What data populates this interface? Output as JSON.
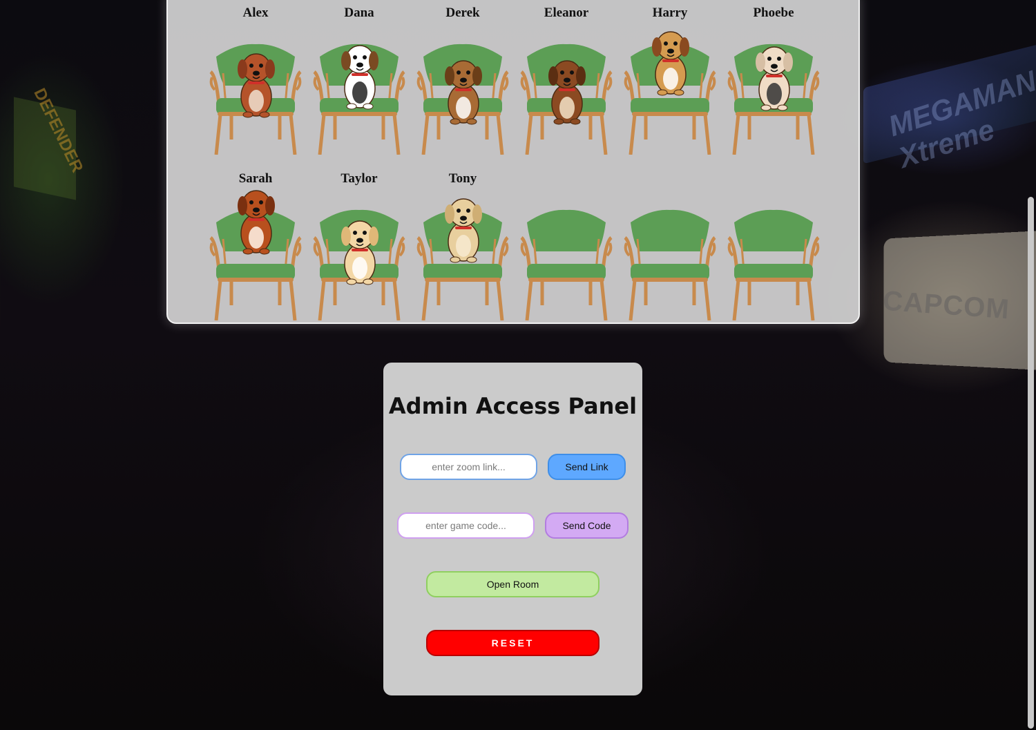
{
  "background": {
    "left_marquee_text": "DEFENDER",
    "right_marquee_text": "MEGAMAN Xtreme",
    "right_cabinet_text": "CAPCOM"
  },
  "seating": {
    "row1": [
      "Alex",
      "Dana",
      "Derek",
      "Eleanor",
      "Harry",
      "Phoebe"
    ],
    "row2": [
      "Sarah",
      "Taylor",
      "Tony",
      "",
      "",
      ""
    ]
  },
  "admin": {
    "title": "Admin Access Panel",
    "zoom_placeholder": "enter zoom link...",
    "send_link_label": "Send Link",
    "code_placeholder": "enter game code...",
    "send_code_label": "Send Code",
    "open_room_label": "Open Room",
    "reset_label": "RESET"
  },
  "colors": {
    "chair_green": "#5c9e55",
    "chair_wood": "#c88a4c",
    "send_link": "#5ea8ff",
    "send_code": "#d3aaf3",
    "open_room": "#c2eaa0",
    "reset": "#ff0000"
  },
  "icons": {
    "chair": "armchair-icon",
    "dog": "dog-avatar-icon"
  }
}
